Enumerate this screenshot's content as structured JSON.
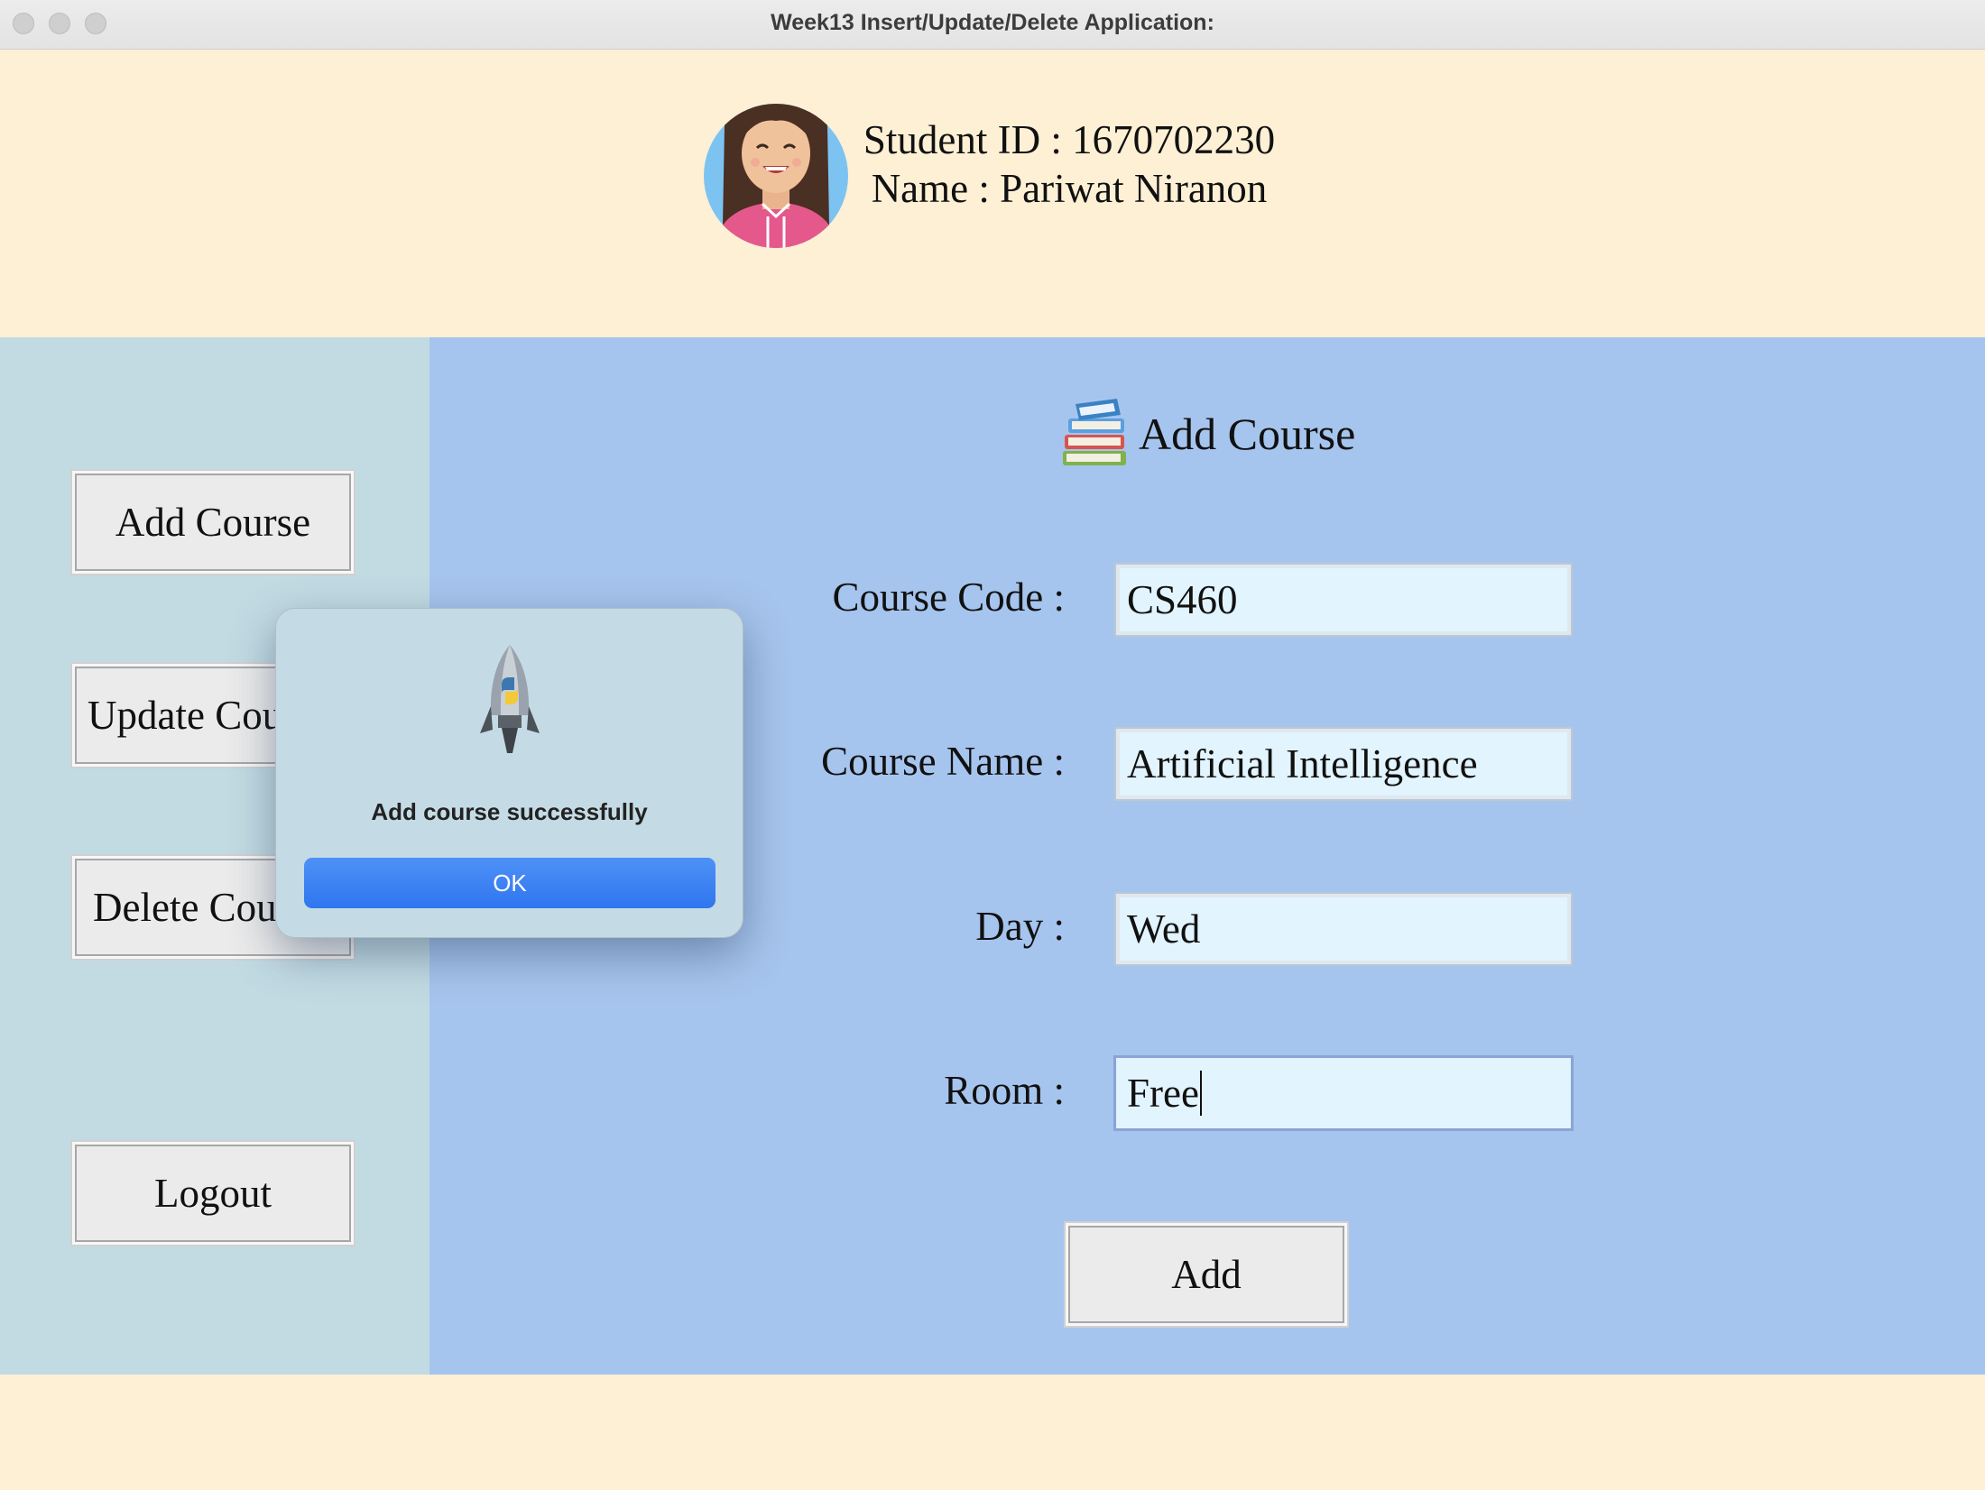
{
  "window": {
    "title": "Week13 Insert/Update/Delete Application:"
  },
  "header": {
    "student_id": "Student ID : 1670702230",
    "name": "Name : Pariwat Niranon"
  },
  "sidebar": {
    "items": [
      {
        "label": "Add Course"
      },
      {
        "label": "Update Course"
      },
      {
        "label": "Delete Course"
      },
      {
        "label": "Logout"
      }
    ]
  },
  "main": {
    "title": "Add Course",
    "fields": [
      {
        "label": "Course Code :",
        "value": "CS460"
      },
      {
        "label": "Course Name :",
        "value": "Artificial Intelligence"
      },
      {
        "label": "Day :",
        "value": "Wed"
      },
      {
        "label": "Room :",
        "value": "Free"
      }
    ],
    "add_button": "Add"
  },
  "dialog": {
    "message": "Add course successfully",
    "ok_label": "OK",
    "ok_color": "#3a82f6"
  },
  "colors": {
    "header_bg": "#fef0d5",
    "sidebar_bg": "#c2dbe3",
    "main_bg": "#a6c5ee",
    "input_bg": "#e2f4fd"
  }
}
